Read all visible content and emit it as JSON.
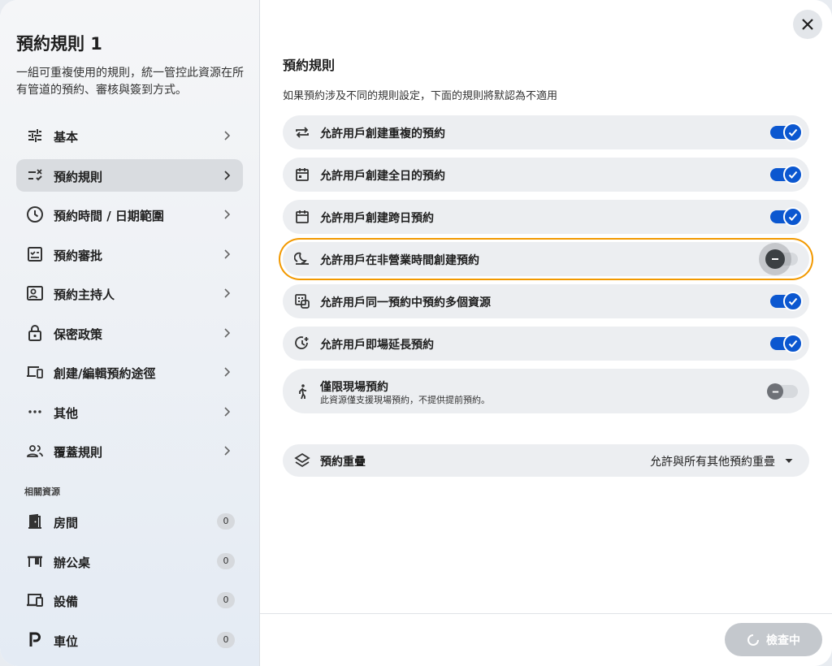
{
  "sidebar": {
    "title": "預約規則 1",
    "description": "一組可重複使用的規則，統一管控此資源在所有管道的預約、審核與簽到方式。",
    "nav": [
      {
        "label": "基本",
        "icon": "tune-icon"
      },
      {
        "label": "預約規則",
        "icon": "rule-icon",
        "active": true
      },
      {
        "label": "預約時間 / 日期範圍",
        "icon": "clock-icon"
      },
      {
        "label": "預約審批",
        "icon": "approval-icon"
      },
      {
        "label": "預約主持人",
        "icon": "host-icon"
      },
      {
        "label": "保密政策",
        "icon": "lock-icon"
      },
      {
        "label": "創建/編輯預約途徑",
        "icon": "devices-icon"
      },
      {
        "label": "其他",
        "icon": "more-icon"
      },
      {
        "label": "覆蓋規則",
        "icon": "group-icon"
      }
    ],
    "related_heading": "相關資源",
    "resources": [
      {
        "label": "房間",
        "count": "0",
        "icon": "door-icon"
      },
      {
        "label": "辦公桌",
        "count": "0",
        "icon": "desk-icon"
      },
      {
        "label": "設備",
        "count": "0",
        "icon": "device-icon"
      },
      {
        "label": "車位",
        "count": "0",
        "icon": "parking-icon"
      }
    ]
  },
  "main": {
    "title": "預約規則",
    "description": "如果預約涉及不同的規則設定，下面的規則將默認為不適用",
    "rules": [
      {
        "label": "允許用戶創建重複的預約",
        "icon": "repeat-icon",
        "enabled": true
      },
      {
        "label": "允許用戶創建全日的預約",
        "icon": "calendar-day-icon",
        "enabled": true
      },
      {
        "label": "允許用戶創建跨日預約",
        "icon": "calendar-icon",
        "enabled": true
      },
      {
        "label": "允許用戶在非營業時間創建預約",
        "icon": "night-icon",
        "enabled": false,
        "focused": true
      },
      {
        "label": "允許用戶同一預約中預約多個資源",
        "icon": "multi-resource-icon",
        "enabled": true
      },
      {
        "label": "允許用戶即場延長預約",
        "icon": "extend-time-icon",
        "enabled": true
      },
      {
        "label": "僅限現場預約",
        "sublabel": "此資源僅支援現場預約，不提供提前預約。",
        "icon": "walk-icon",
        "enabled": false
      }
    ],
    "overlap": {
      "label": "預約重疊",
      "icon": "layers-icon",
      "value": "允許與所有其他預約重疊"
    }
  },
  "footer": {
    "check_label": "檢查中"
  },
  "colors": {
    "accent": "#0b57d0",
    "focus": "#f29900",
    "row_bg": "#eceef1"
  }
}
